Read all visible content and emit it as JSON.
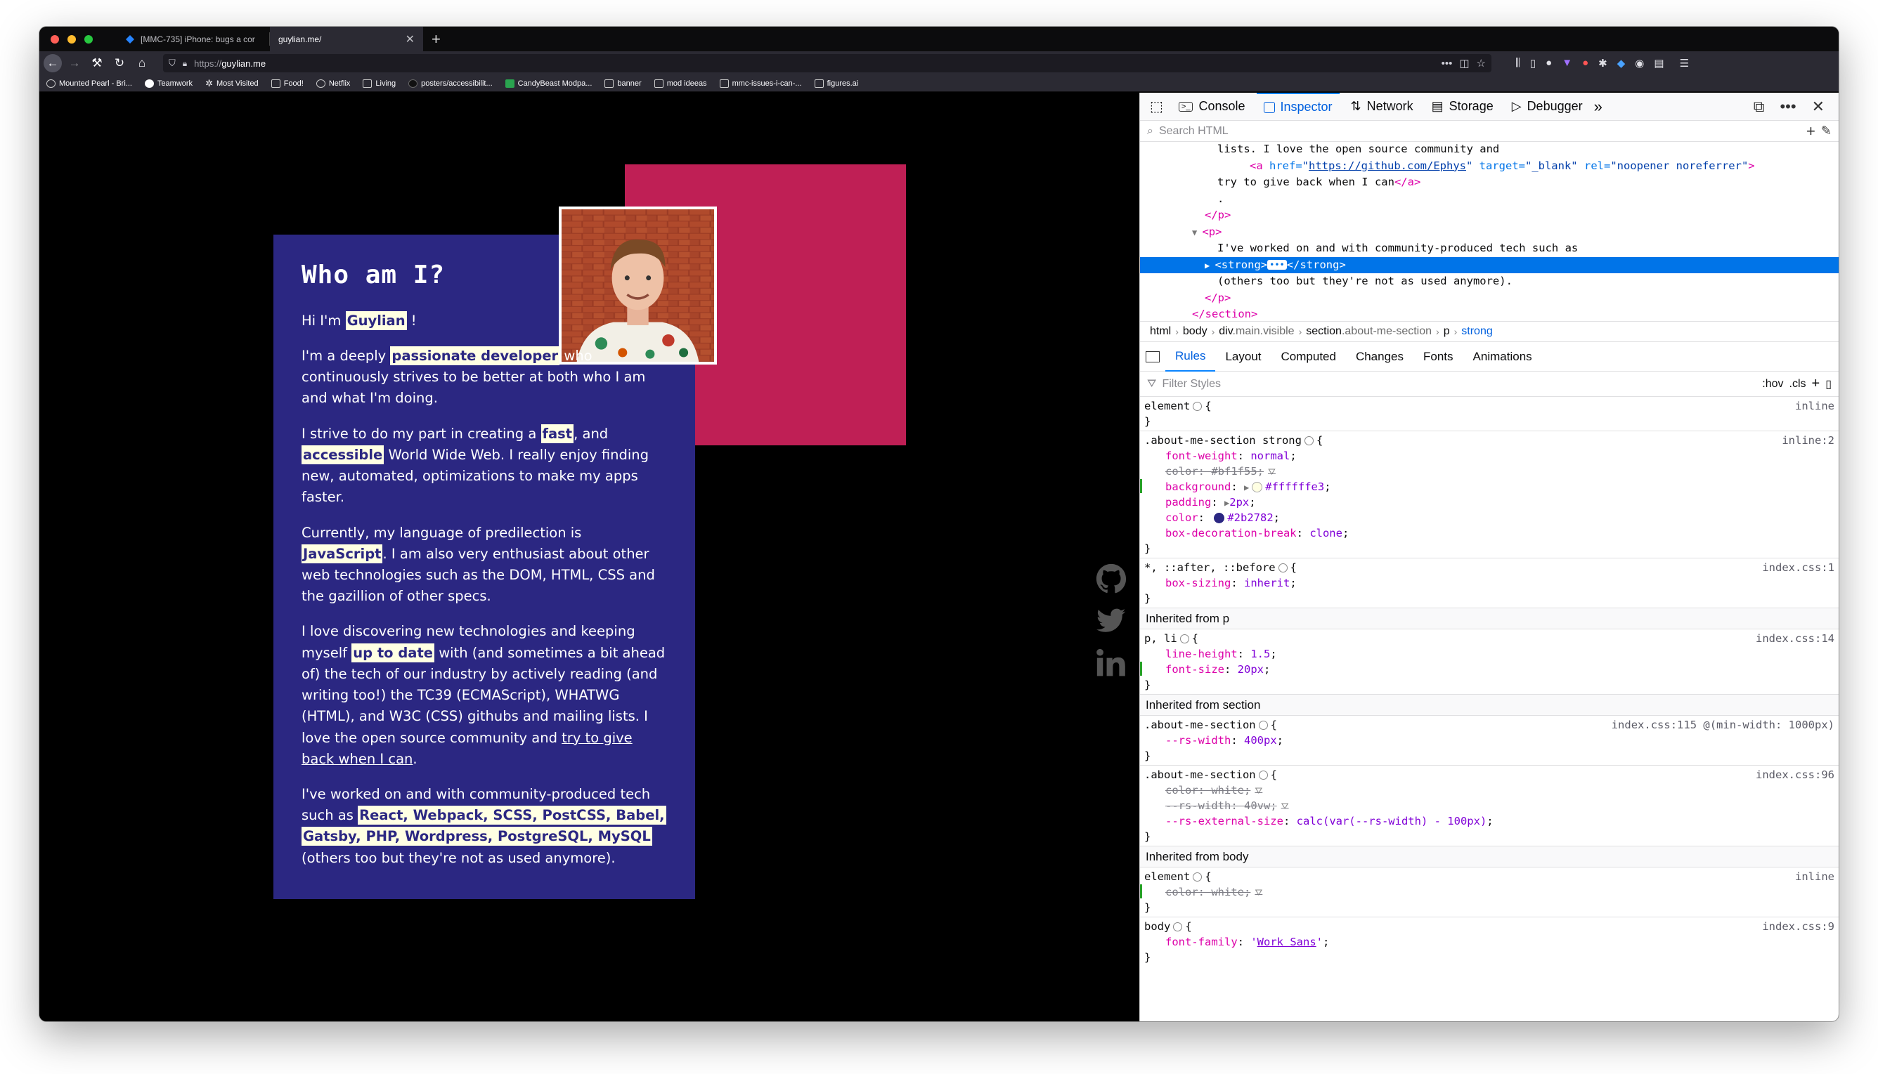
{
  "browser": {
    "tabs": [
      {
        "title": "[MMC-735] iPhone: bugs a cor",
        "active": false,
        "icon": "jira-icon"
      },
      {
        "title": "guylian.me/",
        "active": true,
        "icon": "none"
      }
    ],
    "url_proto": "https://",
    "url_host": "guylian.me",
    "bookmarks": [
      {
        "label": "Mounted Pearl - Bri...",
        "icon": "globe-icon"
      },
      {
        "label": "Teamwork",
        "icon": "teamwork-icon"
      },
      {
        "label": "Most Visited",
        "icon": "gear-icon"
      },
      {
        "label": "Food!",
        "icon": "folder-icon"
      },
      {
        "label": "Netflix",
        "icon": "globe-icon"
      },
      {
        "label": "Living",
        "icon": "folder-icon"
      },
      {
        "label": "posters/accessibilit...",
        "icon": "github-icon"
      },
      {
        "label": "CandyBeast Modpa...",
        "icon": "curseforge-icon"
      },
      {
        "label": "banner",
        "icon": "folder-icon"
      },
      {
        "label": "mod ideeas",
        "icon": "folder-icon"
      },
      {
        "label": "mmc-issues-i-can-...",
        "icon": "folder-icon"
      },
      {
        "label": "figures.ai",
        "icon": "folder-icon"
      }
    ]
  },
  "page": {
    "title": "Who am I?",
    "p1_pre": "Hi I'm ",
    "p1_name": "Guylian",
    "p1_post": " !",
    "p2_pre": "I'm a deeply ",
    "p2_hl": "passionate developer",
    "p2_post": " who continuously strives to be better at both who I am and what I'm doing.",
    "p3_pre": "I strive to do my part in creating a ",
    "p3_hl1": "fast",
    "p3_mid": ", and ",
    "p3_hl2": "accessible",
    "p3_post": " World Wide Web. I really enjoy finding new, automated, optimizations to make my apps faster.",
    "p4_pre": "Currently, my language of predilection is ",
    "p4_hl": "JavaScript",
    "p4_post": ". I am also very enthusiast about other web technologies such as the DOM, HTML, CSS and the gazillion of other specs.",
    "p5_pre": "I love discovering new technologies and keeping myself ",
    "p5_hl": "up to date",
    "p5_post": " with (and sometimes a bit ahead of) the tech of our industry by actively reading (and writing too!) the TC39 (ECMAScript), WHATWG (HTML), and W3C (CSS) githubs and mailing lists. I love the open source community and ",
    "p5_link": "try to give back when I can",
    "p5_end": ".",
    "p6_pre": "I've worked on and with community-produced tech such as ",
    "p6_hl": "React, Webpack, SCSS, PostCSS, Babel, Gatsby, PHP, Wordpress, PostgreSQL, MySQL",
    "p6_post": " (others too but they're not as used anymore).",
    "social": [
      "github-icon",
      "twitter-icon",
      "linkedin-icon"
    ]
  },
  "devtools": {
    "tabs": [
      {
        "label": "Console",
        "icon": "console-icon"
      },
      {
        "label": "Inspector",
        "icon": "inspector-icon",
        "active": true
      },
      {
        "label": "Network",
        "icon": "network-icon"
      },
      {
        "label": "Storage",
        "icon": "storage-icon"
      },
      {
        "label": "Debugger",
        "icon": "debugger-icon"
      }
    ],
    "search_placeholder": "Search HTML",
    "markup": {
      "l1": "lists. I love the open source community and",
      "l2_tag_open": "<a ",
      "l2_href_attr": "href=",
      "l2_href_val": "https://github.com/Ephys",
      "l2_target_attr": "target=",
      "l2_target_val": "\"_blank\"",
      "l2_rel_attr": "rel=",
      "l2_rel_val": "\"noopener noreferrer\"",
      "l2_end": ">",
      "l3_text": "try to give back when I can",
      "l3_close": "</a>",
      "l4": ".",
      "l5": "</p>",
      "l6": "<p>",
      "l7": "I've worked on and with community-produced tech such as",
      "l8_open": "<strong>",
      "l8_ellipsis": "•••",
      "l8_close": "</strong>",
      "l9": "(others too but they're not as used anymore).",
      "l10": "</p>",
      "l11": "</section>"
    },
    "breadcrumbs": [
      {
        "tag": "html",
        "cls": ""
      },
      {
        "tag": "body",
        "cls": ""
      },
      {
        "tag": "div",
        "cls": ".main.visible"
      },
      {
        "tag": "section",
        "cls": ".about-me-section"
      },
      {
        "tag": "p",
        "cls": ""
      },
      {
        "tag": "strong",
        "cls": "",
        "selected": true
      }
    ],
    "sub_tabs": [
      "Rules",
      "Layout",
      "Computed",
      "Changes",
      "Fonts",
      "Animations"
    ],
    "filter_placeholder": "Filter Styles",
    "filter_hov": ":hov",
    "filter_cls": ".cls",
    "rules": {
      "element_sel": "element",
      "inline": "inline",
      "r1_sel": ".about-me-section strong",
      "r1_src": "inline:2",
      "r1_fw_name": "font-weight",
      "r1_fw_val": "normal",
      "r1_color_old_name": "color",
      "r1_color_old_val": "#bf1f55",
      "r1_bg_name": "background",
      "r1_bg_val": "#ffffffe3",
      "r1_pad_name": "padding",
      "r1_pad_val": "2px",
      "r1_color_name": "color",
      "r1_color_val": "#2b2782",
      "r1_bdb_name": "box-decoration-break",
      "r1_bdb_val": "clone",
      "r2_sel": "*, ::after, ::before",
      "r2_src": "index.css:1",
      "r2_bs_name": "box-sizing",
      "r2_bs_val": "inherit",
      "inh_p": "Inherited from p",
      "r3_sel": "p, li",
      "r3_src": "index.css:14",
      "r3_lh_name": "line-height",
      "r3_lh_val": "1.5",
      "r3_fs_name": "font-size",
      "r3_fs_val": "20px",
      "inh_section": "Inherited from section",
      "r4_sel": ".about-me-section",
      "r4_src": "index.css:115 @(min-width: 1000px)",
      "r4_rw_name": "--rs-width",
      "r4_rw_val": "400px",
      "r5_sel": ".about-me-section",
      "r5_src": "index.css:96",
      "r5_color_name": "color",
      "r5_color_val": "white",
      "r5_rw_name": "--rs-width",
      "r5_rw_val": "40vw",
      "r5_ext_name": "--rs-external-size",
      "r5_ext_val": "calc(var(--rs-width) - 100px)",
      "inh_body": "Inherited from body",
      "r6_color_name": "color",
      "r6_color_val": "white",
      "r7_sel": "body",
      "r7_src": "index.css:9",
      "r7_ff_name": "font-family",
      "r7_ff_pre": "'",
      "r7_ff_val": "Work Sans",
      "r7_ff_post": "'"
    }
  },
  "colors": {
    "pink": "#bf1f55",
    "card": "#2b2782",
    "highlight": "#ffffe3"
  }
}
